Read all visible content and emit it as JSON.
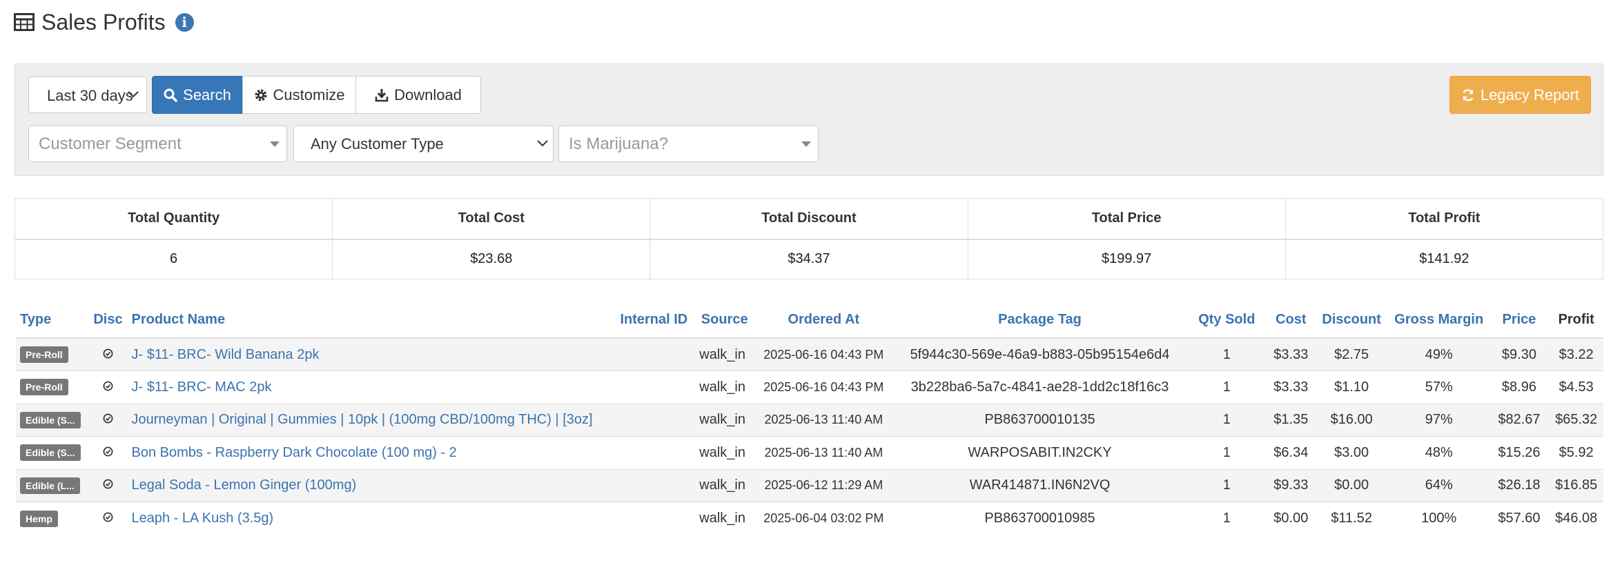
{
  "header": {
    "title": "Sales Profits",
    "title_icon": "table-icon",
    "info_icon": "info-icon"
  },
  "filters": {
    "date_range": "Last 30 days",
    "search_label": "Search",
    "customize_label": "Customize",
    "download_label": "Download",
    "legacy_label": "Legacy Report",
    "customer_segment_placeholder": "Customer Segment",
    "customer_type": "Any Customer Type",
    "marijuana_placeholder": "Is Marijuana?"
  },
  "colors": {
    "primary": "#3776b7",
    "warning": "#efae4e",
    "link": "#3b73b0",
    "badge": "#777777"
  },
  "totals": {
    "headers": [
      "Total Quantity",
      "Total Cost",
      "Total Discount",
      "Total Price",
      "Total Profit"
    ],
    "values": [
      "6",
      "$23.68",
      "$34.37",
      "$199.97",
      "$141.92"
    ]
  },
  "table": {
    "columns": [
      "Type",
      "Disc",
      "Product Name",
      "Internal ID",
      "Source",
      "Ordered At",
      "Package Tag",
      "Qty Sold",
      "Cost",
      "Discount",
      "Gross Margin",
      "Price",
      "Profit"
    ],
    "rows": [
      {
        "type": "Pre-Roll",
        "disc_icon": "check-circle-icon",
        "product": "J- $11- BRC- Wild Banana 2pk",
        "internal_id": "",
        "source": "walk_in",
        "ordered_at": "2025-06-16 04:43 PM",
        "package_tag": "5f944c30-569e-46a9-b883-05b95154e6d4",
        "qty": "1",
        "cost": "$3.33",
        "discount": "$2.75",
        "margin": "49%",
        "price": "$9.30",
        "profit": "$3.22"
      },
      {
        "type": "Pre-Roll",
        "disc_icon": "check-circle-icon",
        "product": "J- $11- BRC- MAC 2pk",
        "internal_id": "",
        "source": "walk_in",
        "ordered_at": "2025-06-16 04:43 PM",
        "package_tag": "3b228ba6-5a7c-4841-ae28-1dd2c18f16c3",
        "qty": "1",
        "cost": "$3.33",
        "discount": "$1.10",
        "margin": "57%",
        "price": "$8.96",
        "profit": "$4.53"
      },
      {
        "type": "Edible (S...",
        "disc_icon": "check-circle-icon",
        "product": "Journeyman | Original | Gummies | 10pk | (100mg CBD/100mg THC) | [3oz]",
        "internal_id": "",
        "source": "walk_in",
        "ordered_at": "2025-06-13 11:40 AM",
        "package_tag": "PB863700010135",
        "qty": "1",
        "cost": "$1.35",
        "discount": "$16.00",
        "margin": "97%",
        "price": "$82.67",
        "profit": "$65.32"
      },
      {
        "type": "Edible (S...",
        "disc_icon": "check-circle-icon",
        "product": "Bon Bombs - Raspberry Dark Chocolate (100 mg) - 2",
        "internal_id": "",
        "source": "walk_in",
        "ordered_at": "2025-06-13 11:40 AM",
        "package_tag": "WARPOSABIT.IN2CKY",
        "qty": "1",
        "cost": "$6.34",
        "discount": "$3.00",
        "margin": "48%",
        "price": "$15.26",
        "profit": "$5.92"
      },
      {
        "type": "Edible (L...",
        "disc_icon": "check-circle-icon",
        "product": "Legal Soda - Lemon Ginger (100mg)",
        "internal_id": "",
        "source": "walk_in",
        "ordered_at": "2025-06-12 11:29 AM",
        "package_tag": "WAR414871.IN6N2VQ",
        "qty": "1",
        "cost": "$9.33",
        "discount": "$0.00",
        "margin": "64%",
        "price": "$26.18",
        "profit": "$16.85"
      },
      {
        "type": "Hemp",
        "disc_icon": "check-circle-icon",
        "product": "Leaph - LA Kush (3.5g)",
        "internal_id": "",
        "source": "walk_in",
        "ordered_at": "2025-06-04 03:02 PM",
        "package_tag": "PB863700010985",
        "qty": "1",
        "cost": "$0.00",
        "discount": "$11.52",
        "margin": "100%",
        "price": "$57.60",
        "profit": "$46.08"
      }
    ]
  }
}
